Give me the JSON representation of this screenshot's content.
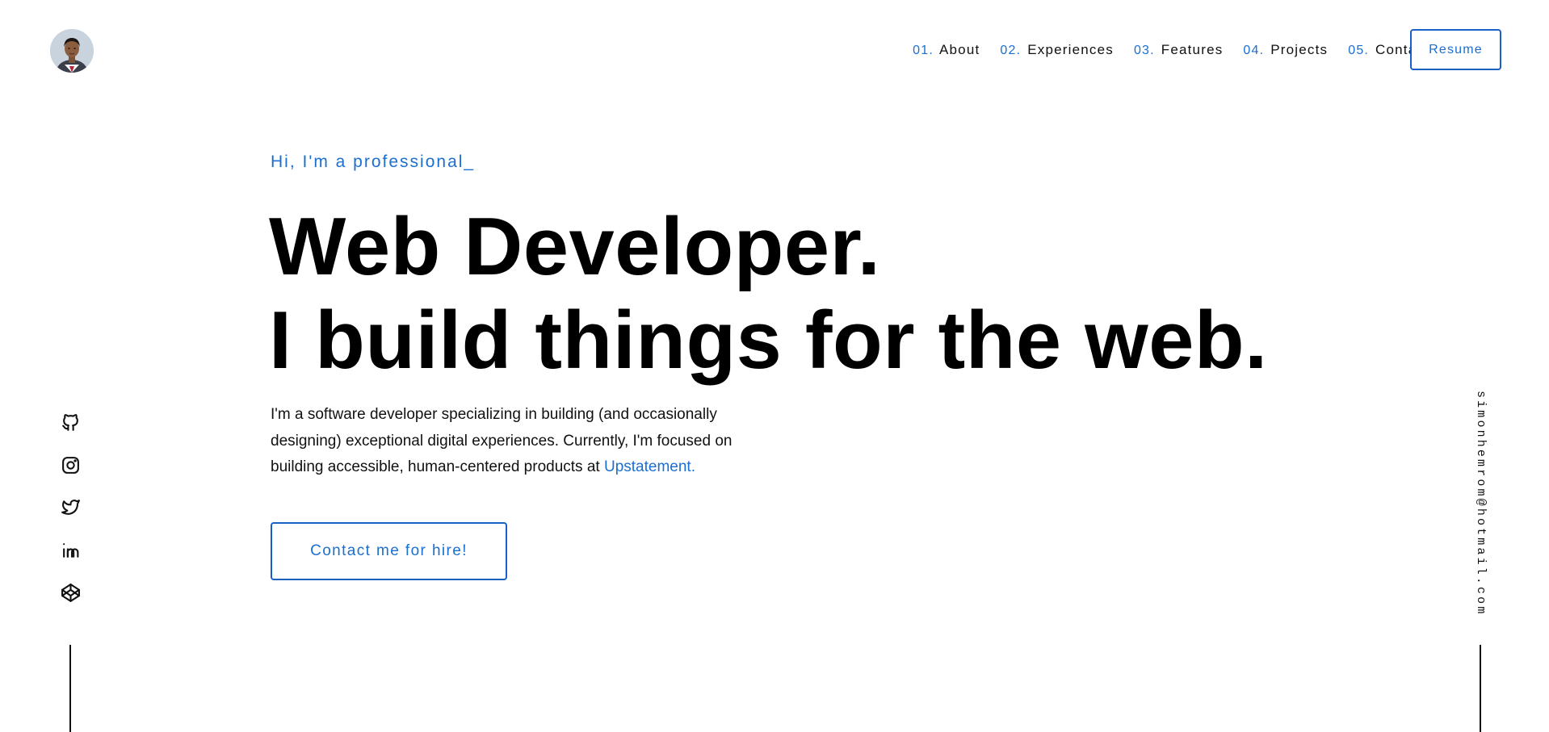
{
  "header": {
    "avatar_icon": "profile-photo",
    "nav": [
      {
        "num": "01.",
        "label": "About"
      },
      {
        "num": "02.",
        "label": "Experiences"
      },
      {
        "num": "03.",
        "label": "Features"
      },
      {
        "num": "04.",
        "label": "Projects"
      },
      {
        "num": "05.",
        "label": "Contact"
      }
    ],
    "resume_label": "Resume"
  },
  "hero": {
    "intro": "Hi, I'm a professional_",
    "headline_line1": "Web Developer.",
    "headline_line2": "I build things for the web.",
    "description": "I'm a software developer specializing in building (and occasionally designing) exceptional digital experiences. Currently, I'm focused on building accessible, human-centered products at ",
    "description_link": "Upstatement.",
    "cta_label": "Contact me for hire!"
  },
  "social": {
    "icons": [
      "github-icon",
      "instagram-icon",
      "twitter-icon",
      "linkedin-icon",
      "codepen-icon"
    ]
  },
  "email": "simonhemrom@hotmail.com",
  "colors": {
    "accent": "#1a6fd1",
    "text": "#0a0a0a",
    "background": "#ffffff"
  }
}
